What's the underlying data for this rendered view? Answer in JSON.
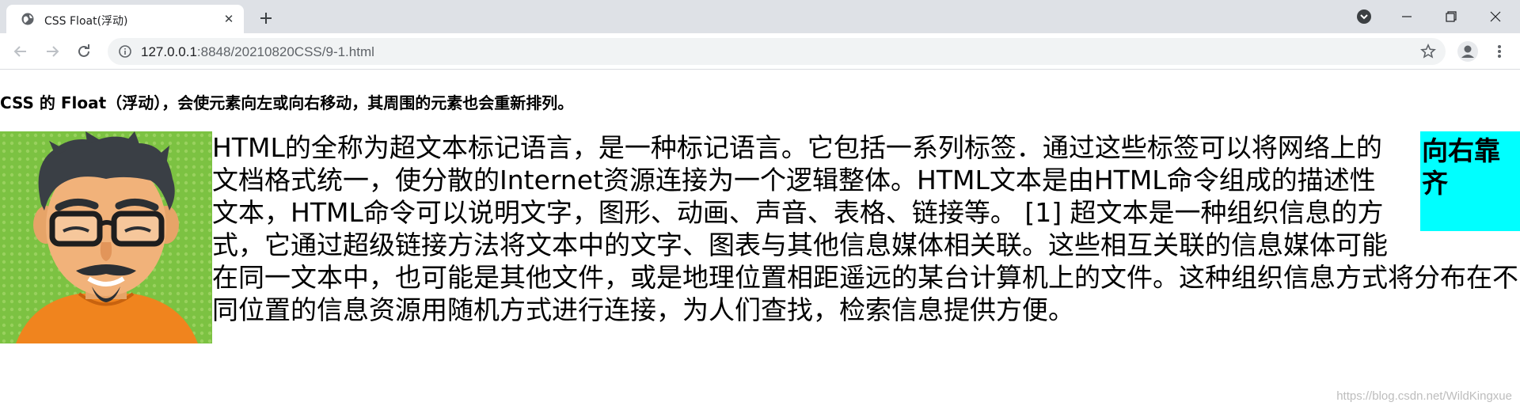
{
  "browser": {
    "tab_title": "CSS Float(浮动)",
    "url_host": "127.0.0.1",
    "url_path": ":8848/20210820CSS/9-1.html"
  },
  "icons": {
    "favicon": "globe-icon",
    "tab_close": "close-icon",
    "new_tab": "plus-icon",
    "back": "arrow-left-icon",
    "forward": "arrow-right-icon",
    "reload": "reload-icon",
    "site_info": "info-icon",
    "bookmark": "star-icon",
    "profile": "account-icon",
    "menu": "kebab-menu-icon",
    "tab_search": "tab-search-icon",
    "minimize": "minimize-icon",
    "maximize": "restore-icon",
    "close_window": "close-icon"
  },
  "page": {
    "heading": "CSS 的 Float（浮动），会使元素向左或向右移动，其周围的元素也会重新排列。",
    "right_box_text": "向右靠齐",
    "paragraph": "HTML的全称为超文本标记语言，是一种标记语言。它包括一系列标签．通过这些标签可以将网络上的文档格式统一，使分散的Internet资源连接为一个逻辑整体。HTML文本是由HTML命令组成的描述性文本，HTML命令可以说明文字，图形、动画、声音、表格、链接等。 [1] 超文本是一种组织信息的方式，它通过超级链接方法将文本中的文字、图表与其他信息媒体相关联。这些相互关联的信息媒体可能在同一文本中，也可能是其他文件，或是地理位置相距遥远的某台计算机上的文件。这种组织信息方式将分布在不同位置的信息资源用随机方式进行连接，为人们查找，检索信息提供方便。",
    "watermark": "https://blog.csdn.net/WildKingxue"
  },
  "colors": {
    "right_box_bg": "#00ffff",
    "chrome_bg": "#dee1e6",
    "avatar_bg": "#7cc242",
    "avatar_shirt": "#f0841e"
  }
}
